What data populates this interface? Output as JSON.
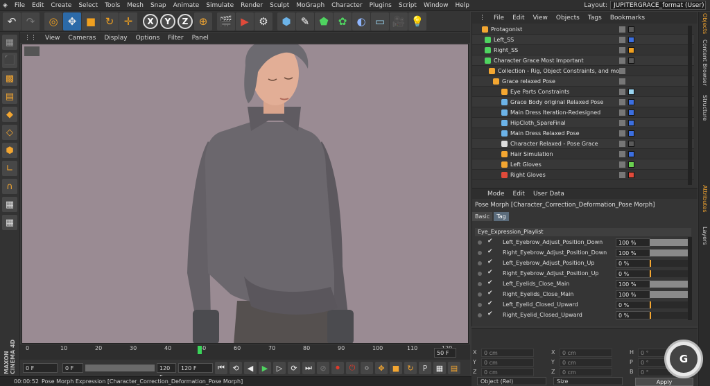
{
  "menubar": {
    "items": [
      "File",
      "Edit",
      "Create",
      "Select",
      "Tools",
      "Mesh",
      "Snap",
      "Animate",
      "Simulate",
      "Render",
      "Sculpt",
      "MoGraph",
      "Character",
      "Plugins",
      "Script",
      "Window",
      "Help"
    ],
    "layout_label": "Layout:",
    "layout_value": "JUPITERGRACE_format (User)"
  },
  "toolbar": {
    "axis_x": "X",
    "axis_y": "Y",
    "axis_z": "Z"
  },
  "viewport_menu": [
    "View",
    "Cameras",
    "Display",
    "Options",
    "Filter",
    "Panel"
  ],
  "timeline": {
    "ticks": [
      "0",
      "10",
      "20",
      "30",
      "40",
      "50",
      "60",
      "70",
      "80",
      "90",
      "100",
      "110",
      "120"
    ],
    "current_frame": 50,
    "start_frame": "0 F",
    "min_field": "0 F",
    "max_field": "120 F",
    "end_frame": "120 F",
    "frame_indicator": "50 F"
  },
  "status": {
    "time": "00:00:52",
    "message": "Pose Morph Expression [Character_Correction_Deformation_Pose Morph]"
  },
  "object_manager": {
    "menu": [
      "File",
      "Edit",
      "View",
      "Objects",
      "Tags",
      "Bookmarks"
    ],
    "rows": [
      {
        "name": "Protagonist",
        "swatch": "#5a5a5a"
      },
      {
        "name": "Left_SS",
        "swatch": "#3c6fe0"
      },
      {
        "name": "Right_SS",
        "swatch": "#f0a020"
      },
      {
        "name": "Character Grace Most Important",
        "swatch": "#5a5a5a"
      },
      {
        "name": "Collection - Rig, Object Constraints, and more",
        "swatch": ""
      },
      {
        "name": "Grace relaxed Pose",
        "swatch": ""
      },
      {
        "name": "Eye Parts Constraints",
        "swatch": "#9ad4f0"
      },
      {
        "name": "Grace Body original Relaxed Pose",
        "swatch": "#3c6fe0"
      },
      {
        "name": "Main Dress Iteration-Redesigned",
        "swatch": "#3c6fe0"
      },
      {
        "name": "HipCloth_SpareFinal",
        "swatch": "#3c6fe0"
      },
      {
        "name": "Main Dress Relaxed Pose",
        "swatch": "#3c6fe0"
      },
      {
        "name": "Character Relaxed - Pose Grace",
        "swatch": "#5a5a5a"
      },
      {
        "name": "Hair Simulation",
        "swatch": "#3c6fe0"
      },
      {
        "name": "Left Gloves",
        "swatch": "#6ad050"
      },
      {
        "name": "Right Gloves",
        "swatch": "#e04a3a"
      }
    ]
  },
  "attribute_manager": {
    "menu": [
      "Mode",
      "Edit",
      "User Data"
    ],
    "title": "Pose Morph [Character_Correction_Deformation_Pose Morph]",
    "tabs": [
      "Basic",
      "Tag"
    ],
    "group": "Eye_Expression_Playlist",
    "params": [
      {
        "label": "Left_Eyebrow_Adjust_Position_Down",
        "value": "100 %",
        "level": 1.0
      },
      {
        "label": "Right_Eyebrow_Adjust_Position_Down",
        "value": "100 %",
        "level": 1.0
      },
      {
        "label": "Left_Eyebrow_Adjust_Position_Up",
        "value": "0 %",
        "level": 0.0
      },
      {
        "label": "Right_Eyebrow_Adjust_Position_Up",
        "value": "0 %",
        "level": 0.0
      },
      {
        "label": "Left_Eyelids_Close_Main",
        "value": "100 %",
        "level": 1.0
      },
      {
        "label": "Right_Eyelids_Close_Main",
        "value": "100 %",
        "level": 1.0
      },
      {
        "label": "Left_Eyelid_Closed_Upward",
        "value": "0 %",
        "level": 0.0
      },
      {
        "label": "Right_Eyelid_Closed_Upward",
        "value": "0 %",
        "level": 0.0
      }
    ]
  },
  "coordinates": {
    "rows": [
      {
        "a": "X",
        "av": "0 cm",
        "b": "X",
        "bv": "0 cm",
        "c": "H",
        "cv": "0 °"
      },
      {
        "a": "Y",
        "av": "0 cm",
        "b": "Y",
        "bv": "0 cm",
        "c": "P",
        "cv": "0 °"
      },
      {
        "a": "Z",
        "av": "0 cm",
        "b": "Z",
        "bv": "0 cm",
        "c": "B",
        "cv": "0 °"
      }
    ],
    "mode": "Object (Rel)",
    "size": "Size",
    "apply": "Apply"
  },
  "vertical_tabs": [
    "Objects",
    "Content Browser",
    "Structure",
    "Attributes",
    "Layers"
  ]
}
